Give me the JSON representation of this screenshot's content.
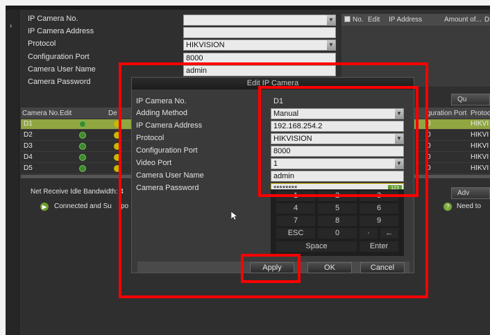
{
  "form": {
    "labels": [
      "IP Camera No.",
      "IP Camera Address",
      "Protocol",
      "Configuration Port",
      "Camera User Name",
      "Camera Password"
    ],
    "protocol_value": "HIKVISION",
    "port_value": "8000",
    "username_value": "admin"
  },
  "right_header": [
    "No.",
    "Edit",
    "IP Address",
    "Amount of...",
    "D"
  ],
  "quick_button": "Qu",
  "adv_button": "Adv",
  "need_text": "Need to",
  "table": {
    "headers": [
      "Camera No.",
      "Edit",
      "De",
      "guration Port",
      "Protoc"
    ],
    "rows": [
      {
        "no": "D1",
        "port": "0",
        "proto": "HIKVI"
      },
      {
        "no": "D2",
        "port": "0",
        "proto": "HIKVI"
      },
      {
        "no": "D3",
        "port": "0",
        "proto": "HIKVI"
      },
      {
        "no": "D4",
        "port": "0",
        "proto": "HIKVI"
      },
      {
        "no": "D5",
        "port": "0",
        "proto": "HIKVI"
      }
    ]
  },
  "net_receive": "Net Receive Idle Bandwidth: 4",
  "connected": "Connected and Su",
  "po_text": "po",
  "dialog": {
    "title": "Edit IP Camera",
    "labels": [
      "IP Camera No.",
      "Adding Method",
      "IP Camera Address",
      "Protocol",
      "Configuration Port",
      "Video Port",
      "Camera User Name",
      "Camera Password"
    ],
    "camera_no": "D1",
    "adding_method": "Manual",
    "ip_address": "192.168.254.2",
    "protocol": "HIKVISION",
    "config_port": "8000",
    "video_port": "1",
    "user_name": "admin",
    "password": "********",
    "input_mode_badge": "123",
    "keypad": {
      "row1": [
        "1",
        "2",
        "3"
      ],
      "row2": [
        "4",
        "5",
        "6"
      ],
      "row3": [
        "7",
        "8",
        "9"
      ],
      "row4": [
        "ESC",
        "0",
        "·",
        "←"
      ],
      "space": "Space",
      "enter": "Enter"
    },
    "buttons": {
      "apply": "Apply",
      "ok": "OK",
      "cancel": "Cancel"
    }
  },
  "colors": {
    "highlight": "#ff0000",
    "selected_row": "#8fa641",
    "background": "#2f2f2f"
  }
}
